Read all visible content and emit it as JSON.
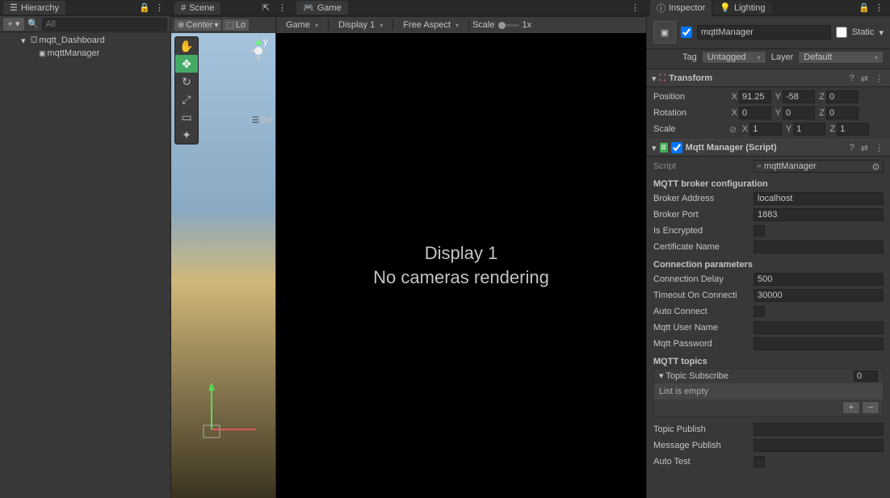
{
  "hierarchy": {
    "tab": "Hierarchy",
    "search_placeholder": "All",
    "items": [
      "mqtt_Dashboard",
      "mqttManager"
    ]
  },
  "scene": {
    "tab": "Scene",
    "center_label": "Center",
    "local_label": "Lo",
    "axis_y": "y",
    "back_label": "Ba"
  },
  "game": {
    "tab": "Game",
    "dd_game": "Game",
    "dd_display": "Display 1",
    "dd_aspect": "Free Aspect",
    "scale_label": "Scale",
    "scale_value": "1x",
    "msg1": "Display 1",
    "msg2": "No cameras rendering"
  },
  "inspector": {
    "tab_inspector": "Inspector",
    "tab_lighting": "Lighting",
    "object_name": "mqttManager",
    "static_label": "Static",
    "tag_label": "Tag",
    "tag_value": "Untagged",
    "layer_label": "Layer",
    "layer_value": "Default",
    "transform": {
      "title": "Transform",
      "position_label": "Position",
      "rotation_label": "Rotation",
      "scale_label": "Scale",
      "pos": {
        "x": "91.25",
        "y": "-58",
        "z": "0"
      },
      "rot": {
        "x": "0",
        "y": "0",
        "z": "0"
      },
      "scl": {
        "x": "1",
        "y": "1",
        "z": "1"
      }
    },
    "mqtt": {
      "title": "Mqtt Manager (Script)",
      "script_label": "Script",
      "script_value": "mqttManager",
      "section_broker": "MQTT broker configuration",
      "broker_address_label": "Broker Address",
      "broker_address": "localhost",
      "broker_port_label": "Broker Port",
      "broker_port": "1883",
      "is_encrypted_label": "Is Encrypted",
      "certificate_label": "Certificate Name",
      "certificate": "",
      "section_conn": "Connection parameters",
      "conn_delay_label": "Connection Delay",
      "conn_delay": "500",
      "timeout_label": "Timeout On Connecti",
      "timeout": "30000",
      "auto_connect_label": "Auto Connect",
      "user_label": "Mqtt User Name",
      "user": "",
      "password_label": "Mqtt Password",
      "password": "",
      "section_topics": "MQTT topics",
      "topic_sub_label": "Topic Subscribe",
      "topic_sub_count": "0",
      "list_empty": "List is empty",
      "topic_pub_label": "Topic Publish",
      "topic_pub": "",
      "msg_pub_label": "Message Publish",
      "msg_pub": "",
      "auto_test_label": "Auto Test"
    }
  }
}
